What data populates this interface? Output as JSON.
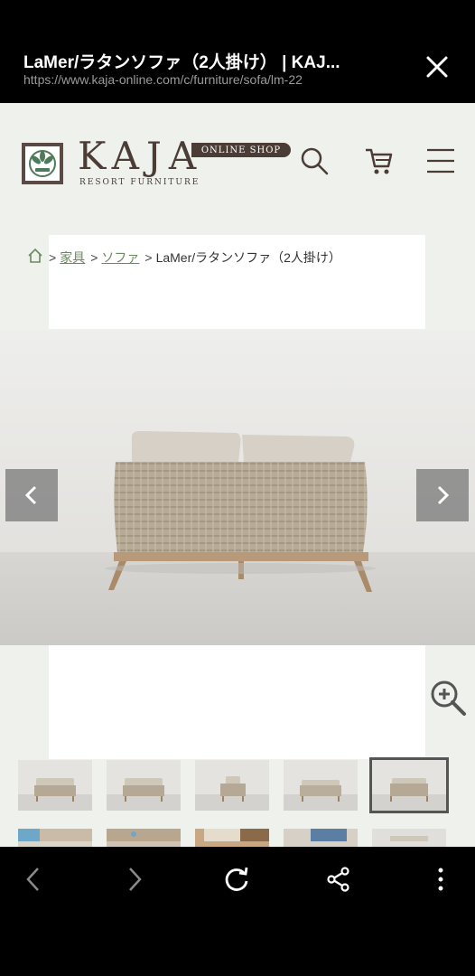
{
  "browser": {
    "title": "LaMer/ラタンソファ（2人掛け） | KAJ...",
    "url": "https://www.kaja-online.com/c/furniture/sofa/lm-22"
  },
  "header": {
    "brand": "KAJA",
    "brand_sub": "RESORT FURNITURE",
    "shop_badge": "ONLINE SHOP"
  },
  "breadcrumb": {
    "items": [
      "家具",
      "ソファ"
    ],
    "current": "LaMer/ラタンソファ（2人掛け）",
    "separator": ">"
  },
  "colors": {
    "brand": "#4b3c36",
    "link": "#6b8a5c",
    "page_bg": "#eef1ec"
  },
  "icons": [
    "close-icon",
    "home-icon",
    "search-icon",
    "cart-icon",
    "menu-icon",
    "chevron-left-icon",
    "chevron-right-icon",
    "zoom-in-icon",
    "back-icon",
    "forward-icon",
    "reload-icon",
    "share-icon",
    "more-vert-icon"
  ]
}
